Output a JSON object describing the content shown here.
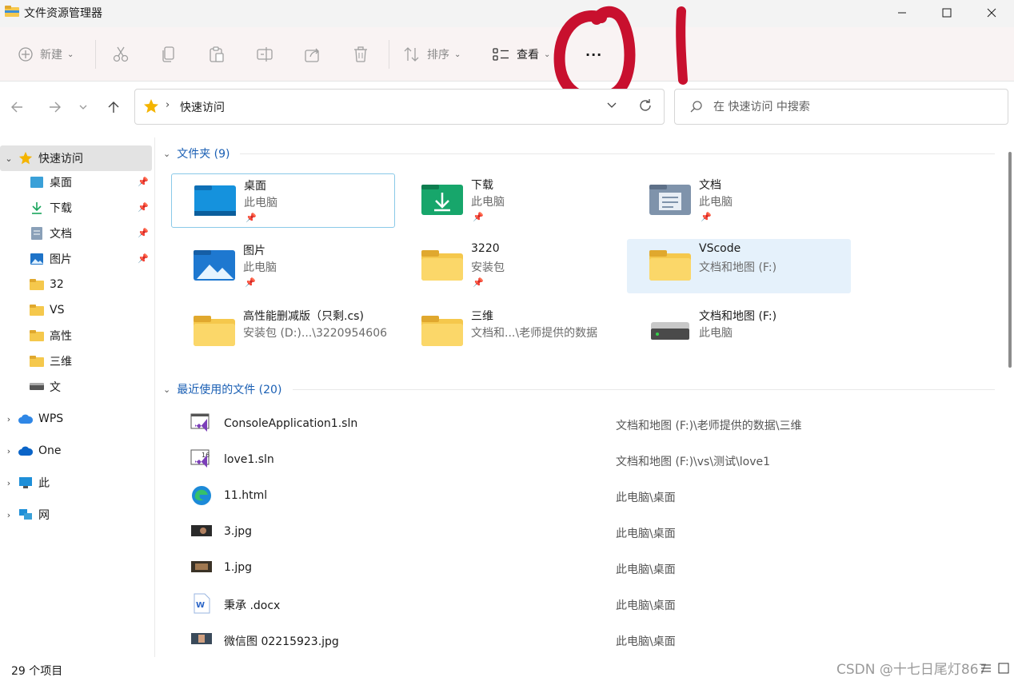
{
  "window": {
    "title": "文件资源管理器",
    "minimize_icon": "minimize-icon",
    "maximize_icon": "maximize-icon",
    "close_icon": "close-icon"
  },
  "commandbar": {
    "new_label": "新建",
    "sort_label": "排序",
    "view_label": "查看",
    "more_label": "···"
  },
  "address": {
    "path": "快速访问",
    "search_placeholder": "在 快速访问 中搜索"
  },
  "sidebar": {
    "items": [
      {
        "label": "快速访问",
        "icon": "star-icon"
      },
      {
        "label": "桌面",
        "icon": "desktop-icon"
      },
      {
        "label": "下载",
        "icon": "download-icon"
      },
      {
        "label": "文档",
        "icon": "document-icon"
      },
      {
        "label": "图片",
        "icon": "picture-icon"
      },
      {
        "label": "32",
        "icon": "folder-icon"
      },
      {
        "label": "VS",
        "icon": "folder-icon"
      },
      {
        "label": "高性",
        "icon": "folder-icon"
      },
      {
        "label": "三维",
        "icon": "folder-icon"
      },
      {
        "label": "文",
        "icon": "drive-icon"
      },
      {
        "label": "WPS",
        "icon": "cloud-icon"
      },
      {
        "label": "One",
        "icon": "onedrive-icon"
      },
      {
        "label": "此",
        "icon": "computer-icon"
      },
      {
        "label": "网",
        "icon": "network-icon"
      }
    ]
  },
  "folders": {
    "header": "文件夹 (9)",
    "items": [
      {
        "name": "桌面",
        "sub": "此电脑",
        "pinned": true
      },
      {
        "name": "下载",
        "sub": "此电脑",
        "pinned": true
      },
      {
        "name": "文档",
        "sub": "此电脑",
        "pinned": true
      },
      {
        "name": "图片",
        "sub": "此电脑",
        "pinned": true
      },
      {
        "name": "3220",
        "sub": "安装包",
        "pinned": true
      },
      {
        "name": "VScode",
        "sub": "文档和地图 (F:)",
        "pinned": false
      },
      {
        "name": "高性能删减版（只剩.cs)",
        "sub": "安装包 (D:)...\\3220954606",
        "pinned": false
      },
      {
        "name": "三维",
        "sub": "文档和...\\老师提供的数据",
        "pinned": false
      },
      {
        "name": "文档和地图 (F:)",
        "sub": "此电脑",
        "pinned": false
      }
    ]
  },
  "recent": {
    "header": "最近使用的文件 (20)",
    "items": [
      {
        "name": "ConsoleApplication1.sln",
        "location": "文档和地图 (F:)\\老师提供的数据\\三维"
      },
      {
        "name": "love1.sln",
        "location": "文档和地图 (F:)\\vs\\测试\\love1"
      },
      {
        "name": "11.html",
        "location": "此电脑\\桌面"
      },
      {
        "name": "3.jpg",
        "location": "此电脑\\桌面"
      },
      {
        "name": "1.jpg",
        "location": "此电脑\\桌面"
      },
      {
        "name": "秉承 .docx",
        "location": "此电脑\\桌面"
      },
      {
        "name": "微信图 02215923.jpg",
        "location": "此电脑\\桌面"
      }
    ]
  },
  "status": {
    "count": "29 个项目",
    "watermark": "CSDN @十七日尾灯867"
  },
  "colors": {
    "accent": "#1a5fb4",
    "annotation": "#c8102e",
    "folder": "#f5c84c"
  }
}
